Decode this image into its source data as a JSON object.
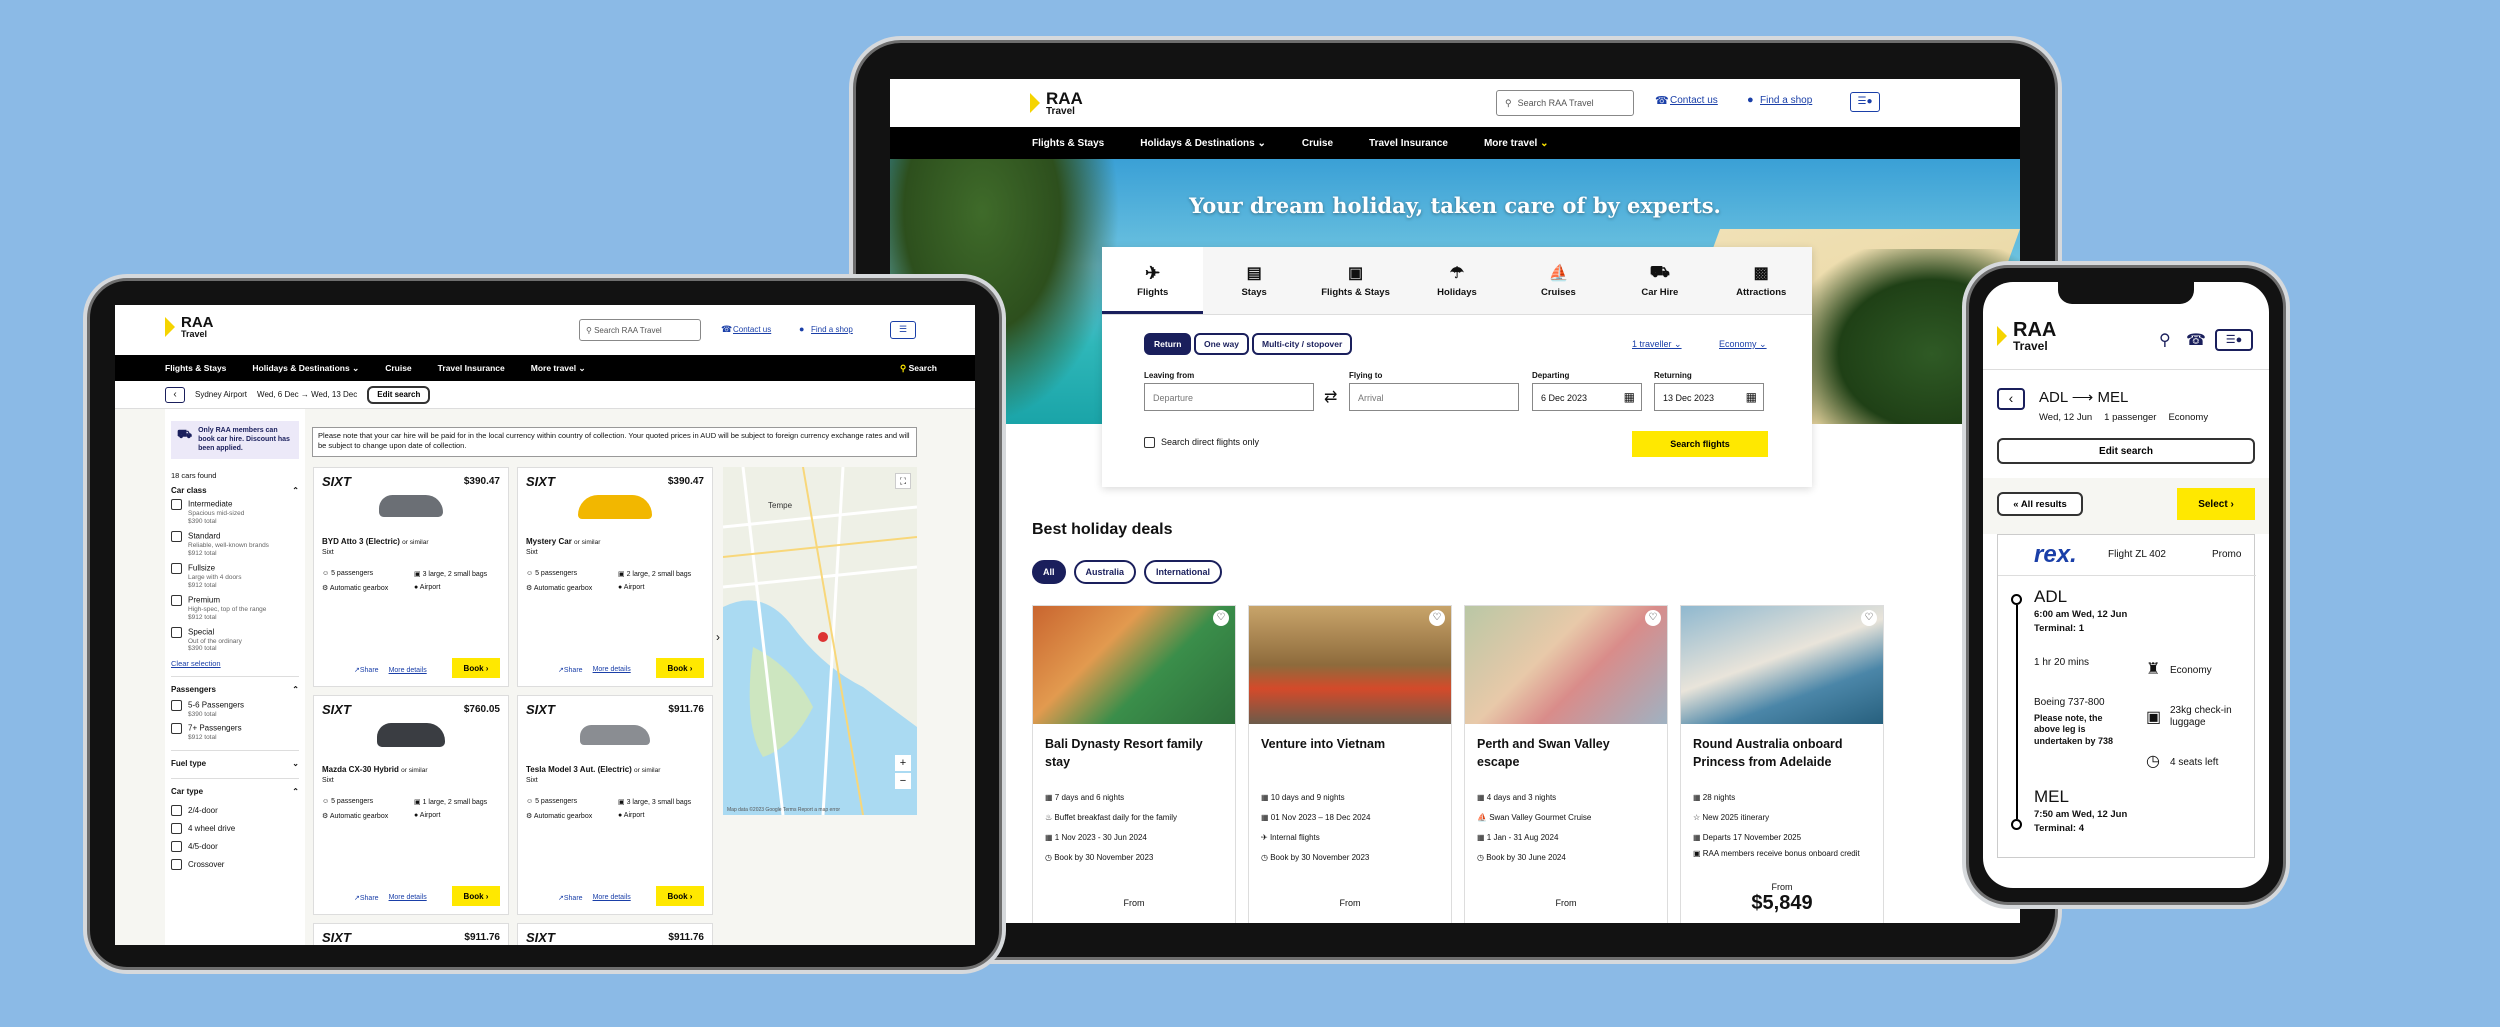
{
  "brand": {
    "line1": "RAA",
    "line2": "Travel",
    "yellow": "#ffe800",
    "navy": "#1a1f5c"
  },
  "header": {
    "search_placeholder": "Search RAA Travel",
    "contact": "Contact us",
    "shop": "Find a shop"
  },
  "nav": {
    "items": [
      "Flights & Stays",
      "Holidays & Destinations",
      "Cruise",
      "Travel Insurance",
      "More travel"
    ],
    "search": "Search"
  },
  "laptop": {
    "hero_title": "Your dream holiday, taken care of by experts.",
    "tabs": [
      {
        "label": "Flights",
        "icon": "plane-icon"
      },
      {
        "label": "Stays",
        "icon": "bed-icon"
      },
      {
        "label": "Flights & Stays",
        "icon": "luggage-icon"
      },
      {
        "label": "Holidays",
        "icon": "beach-icon"
      },
      {
        "label": "Cruises",
        "icon": "ship-icon"
      },
      {
        "label": "Car Hire",
        "icon": "car-icon"
      },
      {
        "label": "Attractions",
        "icon": "ticket-icon"
      }
    ],
    "trip_types": [
      "Return",
      "One way",
      "Multi-city / stopover"
    ],
    "traveller": "1 traveller",
    "cabin": "Economy",
    "leaving_label": "Leaving from",
    "leaving_placeholder": "Departure",
    "flying_label": "Flying to",
    "flying_placeholder": "Arrival",
    "departing_label": "Departing",
    "departing_value": "6 Dec 2023",
    "returning_label": "Returning",
    "returning_value": "13 Dec 2023",
    "direct_only": "Search direct flights only",
    "search_btn": "Search flights",
    "deals_title": "Best holiday deals",
    "filters": [
      "All",
      "Australia",
      "International"
    ],
    "deals": [
      {
        "title": "Bali Dynasty Resort family stay",
        "items": [
          "7 days and 6 nights",
          "Buffet breakfast daily for the family",
          "1 Nov 2023 - 30 Jun 2024",
          "Book by 30 November 2023"
        ],
        "from": "From",
        "price": ""
      },
      {
        "title": "Venture into Vietnam",
        "items": [
          "10 days and 9 nights",
          "01 Nov 2023 – 18 Dec 2024",
          "Internal flights",
          "Book by 30 November 2023"
        ],
        "from": "From",
        "price": ""
      },
      {
        "title": "Perth and Swan Valley escape",
        "items": [
          "4 days and 3 nights",
          "Swan Valley Gourmet Cruise",
          "1 Jan - 31 Aug 2024",
          "Book by 30 June 2024"
        ],
        "from": "From",
        "price": ""
      },
      {
        "title": "Round Australia onboard Princess from Adelaide",
        "items": [
          "28 nights",
          "New 2025 itinerary",
          "Departs 17 November 2025",
          "RAA members receive bonus onboard credit"
        ],
        "from": "From",
        "price": "$5,849"
      }
    ]
  },
  "tablet": {
    "location": "Sydney Airport",
    "dates": "Wed, 6 Dec",
    "dates2": "Wed, 13 Dec",
    "edit": "Edit search",
    "notice": "Please note that your car hire will be paid for in the local currency within country of collection. Your quoted prices in AUD will be subject to foreign currency exchange rates and will be subject to change upon date of collection.",
    "promo": "Only RAA members can book car hire. Discount has been applied.",
    "found": "18 cars found",
    "car_class_title": "Car class",
    "car_class": [
      {
        "name": "Intermediate",
        "desc": "Spacious mid-sized",
        "total": "$390 total"
      },
      {
        "name": "Standard",
        "desc": "Reliable, well-known brands",
        "total": "$912 total"
      },
      {
        "name": "Fullsize",
        "desc": "Large with 4 doors",
        "total": "$912 total"
      },
      {
        "name": "Premium",
        "desc": "High-spec, top of the range",
        "total": "$912 total"
      },
      {
        "name": "Special",
        "desc": "Out of the ordinary",
        "total": "$390 total"
      }
    ],
    "clear": "Clear selection",
    "passengers_title": "Passengers",
    "passengers": [
      {
        "name": "5-6 Passengers",
        "total": "$390 total"
      },
      {
        "name": "7+ Passengers",
        "total": "$912 total"
      }
    ],
    "fuel_title": "Fuel type",
    "car_type_title": "Car type",
    "car_types": [
      "2/4-door",
      "4 wheel drive",
      "4/5-door",
      "Crossover"
    ],
    "cars": [
      {
        "brand": "SIXT",
        "price": "$390.47",
        "name": "BYD Atto 3 (Electric)",
        "similar": "or similar",
        "supplier": "Sixt",
        "pax": "5 passengers",
        "bags": "3 large, 2 small bags",
        "gear": "Automatic gearbox",
        "loc": "Airport",
        "color": "#6b6f75"
      },
      {
        "brand": "SIXT",
        "price": "$390.47",
        "name": "Mystery Car",
        "similar": "or similar",
        "supplier": "Sixt",
        "pax": "5 passengers",
        "bags": "2 large, 2 small bags",
        "gear": "Automatic gearbox",
        "loc": "Airport",
        "color": "#f2b700"
      },
      {
        "brand": "SIXT",
        "price": "$760.05",
        "name": "Mazda CX-30 Hybrid",
        "similar": "or similar",
        "supplier": "Sixt",
        "pax": "5 passengers",
        "bags": "1 large, 2 small bags",
        "gear": "Automatic gearbox",
        "loc": "Airport",
        "color": "#3a3d42"
      },
      {
        "brand": "SIXT",
        "price": "$911.76",
        "name": "Tesla Model 3 Aut. (Electric)",
        "similar": "or similar",
        "supplier": "Sixt",
        "pax": "5 passengers",
        "bags": "3 large, 3 small bags",
        "gear": "Automatic gearbox",
        "loc": "Airport",
        "color": "#8a8d92"
      }
    ],
    "more_prices": [
      "$911.76",
      "$911.76"
    ],
    "share": "Share",
    "more": "More details",
    "book": "Book",
    "map_label": "Tempe",
    "map_footer": "Map data ©2023 Google   Terms   Report a map error"
  },
  "phone": {
    "from": "ADL",
    "to": "MEL",
    "date": "Wed, 12 Jun",
    "pax": "1 passenger",
    "cabin": "Economy",
    "edit": "Edit search",
    "all_results": "All results",
    "select": "Select",
    "airline": "rex.",
    "flight": "Flight ZL 402",
    "fare": "Promo",
    "dep_code": "ADL",
    "dep_time": "6:00 am  Wed, 12 Jun",
    "dep_terminal": "Terminal: 1",
    "duration": "1 hr 20 mins",
    "aircraft": "Boeing 737-800",
    "aircraft_note": "Please note, the above leg is undertaken by 738",
    "economy": "Economy",
    "baggage": "23kg check-in luggage",
    "seats": "4 seats left",
    "arr_code": "MEL",
    "arr_time": "7:50 am  Wed, 12 Jun",
    "arr_terminal": "Terminal: 4"
  }
}
